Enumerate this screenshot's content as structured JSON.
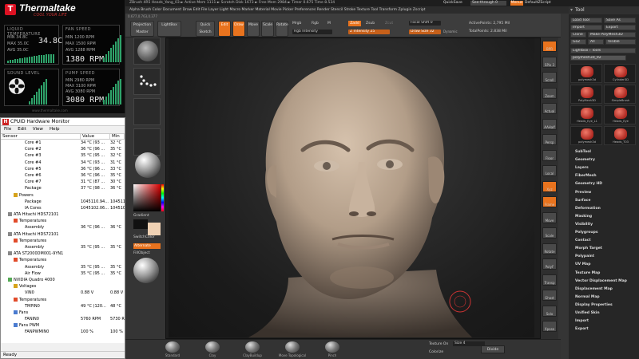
{
  "thermaltake": {
    "brand": "Thermaltake",
    "tagline": "COOL YOUR LIFE",
    "liquid": {
      "header": "LIQUID TEMPERATURE",
      "min": "MIN 34.8C",
      "max": "MAX 35.0C",
      "avg": "AVG 35.0C",
      "big": "34.8C"
    },
    "fan": {
      "header": "FAN SPEED",
      "min": "MIN 1200 RPM",
      "max": "MAX 1500 RPM",
      "avg": "AVG 1288 RPM",
      "big": "1380 RPM"
    },
    "sound": {
      "header": "SOUND LEVEL"
    },
    "pump": {
      "header": "PUMP SPEED",
      "min": "MIN 2980 RPM",
      "max": "MAX 3100 RPM",
      "avg": "AVG 3080 RPM",
      "big": "3080 RPM"
    },
    "footer": "www.thermaltake.com",
    "colors": {
      "accent": "#d12",
      "bars": "#2fa36a"
    }
  },
  "hwmonitor": {
    "title": "CPUID Hardware Monitor",
    "menu": [
      "File",
      "Edit",
      "View",
      "Help"
    ],
    "columns": {
      "sensor": "Sensor",
      "value": "Value",
      "min": "Min"
    },
    "rows": [
      {
        "indent": 4,
        "icon": "",
        "name": "Core #1",
        "value": "34 °C  (93 ...",
        "min": "32 °C"
      },
      {
        "indent": 4,
        "icon": "",
        "name": "Core #2",
        "value": "36 °C  (96 ...",
        "min": "35 °C"
      },
      {
        "indent": 4,
        "icon": "",
        "name": "Core #3",
        "value": "35 °C  (95 ...",
        "min": "32 °C"
      },
      {
        "indent": 4,
        "icon": "",
        "name": "Core #4",
        "value": "34 °C  (93 ...",
        "min": "31 °C"
      },
      {
        "indent": 4,
        "icon": "",
        "name": "Core #5",
        "value": "36 °C  (96 ...",
        "min": "33 °C"
      },
      {
        "indent": 4,
        "icon": "",
        "name": "Core #6",
        "value": "36 °C  (96 ...",
        "min": "35 °C"
      },
      {
        "indent": 4,
        "icon": "",
        "name": "Core #7",
        "value": "31 °C  (87 ...",
        "min": "30 °C"
      },
      {
        "indent": 4,
        "icon": "",
        "name": "Package",
        "value": "37 °C  (98 ...",
        "min": "36 °C"
      },
      {
        "indent": 2,
        "icon": "power",
        "name": "Powers",
        "value": "",
        "min": ""
      },
      {
        "indent": 4,
        "icon": "",
        "name": "Package",
        "value": "1045110.94...",
        "min": "104511"
      },
      {
        "indent": 4,
        "icon": "",
        "name": "IA Cores",
        "value": "1045102.06...",
        "min": "104510"
      },
      {
        "indent": 1,
        "icon": "disk",
        "name": "ATA Hitachi HDS72101",
        "value": "",
        "min": ""
      },
      {
        "indent": 2,
        "icon": "temp",
        "name": "Temperatures",
        "value": "",
        "min": ""
      },
      {
        "indent": 4,
        "icon": "",
        "name": "Assembly",
        "value": "36 °C  (96 ...",
        "min": "36 °C"
      },
      {
        "indent": 1,
        "icon": "disk",
        "name": "ATA Hitachi HDS72101",
        "value": "",
        "min": ""
      },
      {
        "indent": 2,
        "icon": "temp",
        "name": "Temperatures",
        "value": "",
        "min": ""
      },
      {
        "indent": 4,
        "icon": "",
        "name": "Assembly",
        "value": "35 °C  (95 ...",
        "min": "35 °C"
      },
      {
        "indent": 1,
        "icon": "disk",
        "name": "ATA ST2000DM001-9YN1",
        "value": "",
        "min": ""
      },
      {
        "indent": 2,
        "icon": "temp",
        "name": "Temperatures",
        "value": "",
        "min": ""
      },
      {
        "indent": 4,
        "icon": "",
        "name": "Assembly",
        "value": "35 °C  (95 ...",
        "min": "35 °C"
      },
      {
        "indent": 4,
        "icon": "",
        "name": "Air Flow",
        "value": "35 °C  (95 ...",
        "min": "35 °C"
      },
      {
        "indent": 1,
        "icon": "gpu",
        "name": "NVIDIA Quadro 4000",
        "value": "",
        "min": ""
      },
      {
        "indent": 2,
        "icon": "volt",
        "name": "Voltages",
        "value": "",
        "min": ""
      },
      {
        "indent": 4,
        "icon": "",
        "name": "VIN0",
        "value": "0.88 V",
        "min": "0.88 V"
      },
      {
        "indent": 2,
        "icon": "temp",
        "name": "Temperatures",
        "value": "",
        "min": ""
      },
      {
        "indent": 4,
        "icon": "",
        "name": "TMPIN0",
        "value": "49 °C  (120...",
        "min": "48 °C"
      },
      {
        "indent": 2,
        "icon": "fan",
        "name": "Fans",
        "value": "",
        "min": ""
      },
      {
        "indent": 4,
        "icon": "",
        "name": "FANIN0",
        "value": "5760 RPM",
        "min": "5730 R"
      },
      {
        "indent": 2,
        "icon": "fan",
        "name": "Fans PWM",
        "value": "",
        "min": ""
      },
      {
        "indent": 4,
        "icon": "",
        "name": "FANPWMIN0",
        "value": "100 %",
        "min": "100 %"
      }
    ],
    "status": "Ready"
  },
  "zbrush": {
    "title": "ZBrush 4R5    Heads_Yang_03    ► Active Mem 1111 ► Scratch Disk 1673 ► Free Mem 2984 ► Timer 0.675 Time 8.534",
    "menu": "Alpha  Brush  Color  Document  Draw  Edit  File  Layer  Light  Macro  Marker  Material  Movie  Picker  Preferences  Render  Stencil  Stroke  Texture  Tool  Transform  Zplugin  Zscript",
    "quicksave": "QuickSave",
    "seethrough": "See-through 0",
    "menus_btn": "Menus",
    "defaultscript": "DefaultZScript",
    "coords": "0.677,0.763,0.377",
    "toolbar": {
      "projection_master": "Projection Master",
      "lightbox": "LightBox",
      "quick_sketch": "Quick Sketch",
      "edit": "Edit",
      "draw": "Draw",
      "move": "Move",
      "scale": "Scale",
      "rotate": "Rotate",
      "mrgb": "Mrgb",
      "rgb": "Rgb",
      "m": "M",
      "rgb_intensity": "Rgb Intensity",
      "zadd": "Zadd",
      "zsub": "Zsub",
      "zcut": "Zcut",
      "z_intensity": "Z Intensity 25",
      "focal_shift": "Focal Shift 0",
      "draw_size": "Draw Size 32",
      "dynamic": "Dynamic",
      "active_points": "ActivePoints: 2,795 Mil",
      "total_points": "TotalPoints: 2.838 Mil"
    },
    "left_tray": {
      "gradient": "Gradient",
      "switch_color": "SwitchColor",
      "alternate": "Alternate",
      "fill_object": "FillObject"
    },
    "right_shelf": [
      "BPR",
      "SPix 3",
      "Scroll",
      "Zoom",
      "Actual",
      "AAHalf",
      "Persp",
      "Floor",
      "Local",
      "Xyz",
      "Frame",
      "Move",
      "Scale",
      "Rotate",
      "PolyF",
      "Transp",
      "Ghost",
      "Solo",
      "Xpose"
    ],
    "bottom": {
      "buttons": [
        "Standard",
        "Clay",
        "ClayBuildup",
        "Move Topological",
        "Pinch"
      ],
      "texture_on": "Texture On",
      "colorize": "Colorize",
      "size": "Size 4",
      "divide": "Divide"
    },
    "tool_palette": {
      "header": "Tool",
      "load_tool": "Load Tool",
      "save_as": "Save As",
      "import": "Import",
      "export": "Export",
      "clone": "Clone",
      "make_polymesh": "Make PolyMesh3D",
      "goz": "GoZ",
      "all": "All",
      "visible": "Visible",
      "lightbox_tools": "Lightbox › Tools",
      "current_tool": "polymesh3d_92",
      "thumbs": [
        "polymesh3d",
        "Cylinder3D",
        "PolyMesh3D",
        "SimpleBrush",
        "Heads_Eye_L1",
        "Heads_Eye",
        "polymesh3d",
        "Heads_T03"
      ],
      "sections": [
        "SubTool",
        "Geometry",
        "Layers",
        "FiberMesh",
        "Geometry HD",
        "Preview",
        "Surface",
        "Deformation",
        "Masking",
        "Visibility",
        "Polygroups",
        "Contact",
        "Morph Target",
        "Polypaint",
        "UV Map",
        "Texture Map",
        "Vector Displacement Map",
        "Displacement Map",
        "Normal Map",
        "Display Properties",
        "Unified Skin",
        "Import",
        "Export"
      ]
    }
  }
}
